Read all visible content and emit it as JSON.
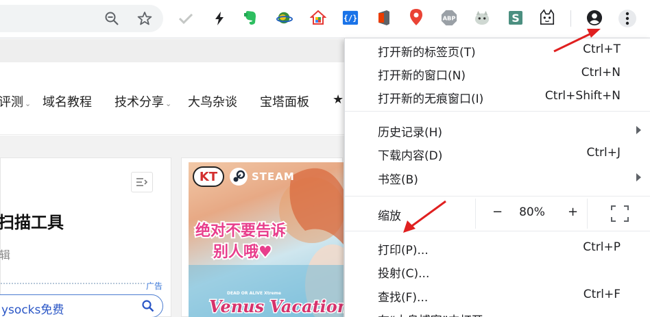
{
  "toolbar": {
    "icons": [
      "zoom-out-icon",
      "bookmark-star-icon",
      "checkmark-extension-icon",
      "bolt-extension-icon",
      "evernote-extension-icon",
      "globe-extension-icon",
      "house-extension-icon",
      "code-extension-icon",
      "office-extension-icon",
      "map-pin-extension-icon",
      "adblock-plus-extension-icon",
      "cat-extension-icon",
      "s-extension-icon",
      "cat-face-extension-icon",
      "profile-icon",
      "more-menu-icon"
    ],
    "adblock_text": "ABP",
    "code_text": "{/}",
    "s_text": "S"
  },
  "site_nav": {
    "items": [
      "评测",
      "域名教程",
      "技术分享",
      "大鸟杂谈",
      "宝塔面板"
    ],
    "star": "★"
  },
  "article": {
    "title": "扫描工具",
    "meta": "辑",
    "ad_label": "广告",
    "search_value": "ysocks免费"
  },
  "ad": {
    "brand_kt": "KT",
    "steam": "STEAM",
    "line1": "绝对不要告诉",
    "line2": "别人哦♥",
    "game_title": "Venus Vacation",
    "game_subtitle": "DEAD OR ALIVE Xtreme"
  },
  "menu": {
    "new_tab": {
      "label": "打开新的标签页(T)",
      "shortcut": "Ctrl+T"
    },
    "new_window": {
      "label": "打开新的窗口(N)",
      "shortcut": "Ctrl+N"
    },
    "new_incognito": {
      "label": "打开新的无痕窗口(I)",
      "shortcut": "Ctrl+Shift+N"
    },
    "history": {
      "label": "历史记录(H)"
    },
    "downloads": {
      "label": "下载内容(D)",
      "shortcut": "Ctrl+J"
    },
    "bookmarks": {
      "label": "书签(B)"
    },
    "zoom": {
      "label": "缩放",
      "minus": "−",
      "value": "80%",
      "plus": "+"
    },
    "print": {
      "label": "打印(P)...",
      "shortcut": "Ctrl+P"
    },
    "cast": {
      "label": "投射(C)..."
    },
    "find": {
      "label": "查找(F)...",
      "shortcut": "Ctrl+F"
    },
    "open_in": {
      "label": "在“大鸟博客”中打开"
    }
  },
  "colors": {
    "annotation_arrow": "#e02020",
    "accent_blue": "#1a73e8"
  }
}
